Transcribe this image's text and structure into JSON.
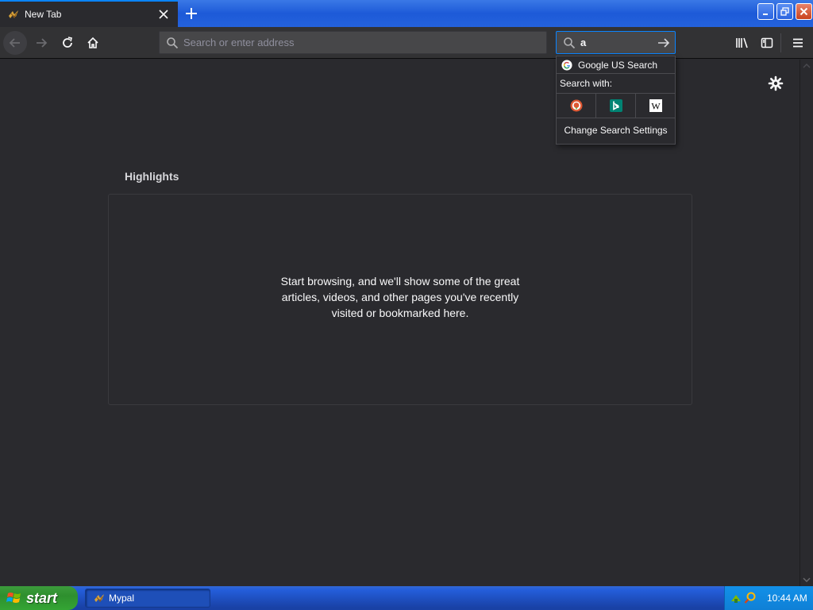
{
  "tab": {
    "title": "New Tab"
  },
  "toolbar": {
    "url_placeholder": "Search or enter address",
    "search_value": "a"
  },
  "search_popup": {
    "default_engine": "Google US Search",
    "search_with_label": "Search with:",
    "engines": [
      "duckduckgo-icon",
      "bing-icon",
      "wikipedia-icon"
    ],
    "settings_label": "Change Search Settings"
  },
  "content": {
    "highlights_title": "Highlights",
    "highlights_message": "Start browsing, and we'll show some of the great articles, videos, and other pages you've recently visited or bookmarked here."
  },
  "taskbar": {
    "start_label": "start",
    "task_label": "Mypal",
    "clock": "10:44 AM"
  },
  "colors": {
    "accent": "#0a84ff",
    "page_bg": "#2a2a2e",
    "toolbar_bg": "#323234",
    "xp_blue": "#245edb",
    "xp_green": "#34a534"
  }
}
